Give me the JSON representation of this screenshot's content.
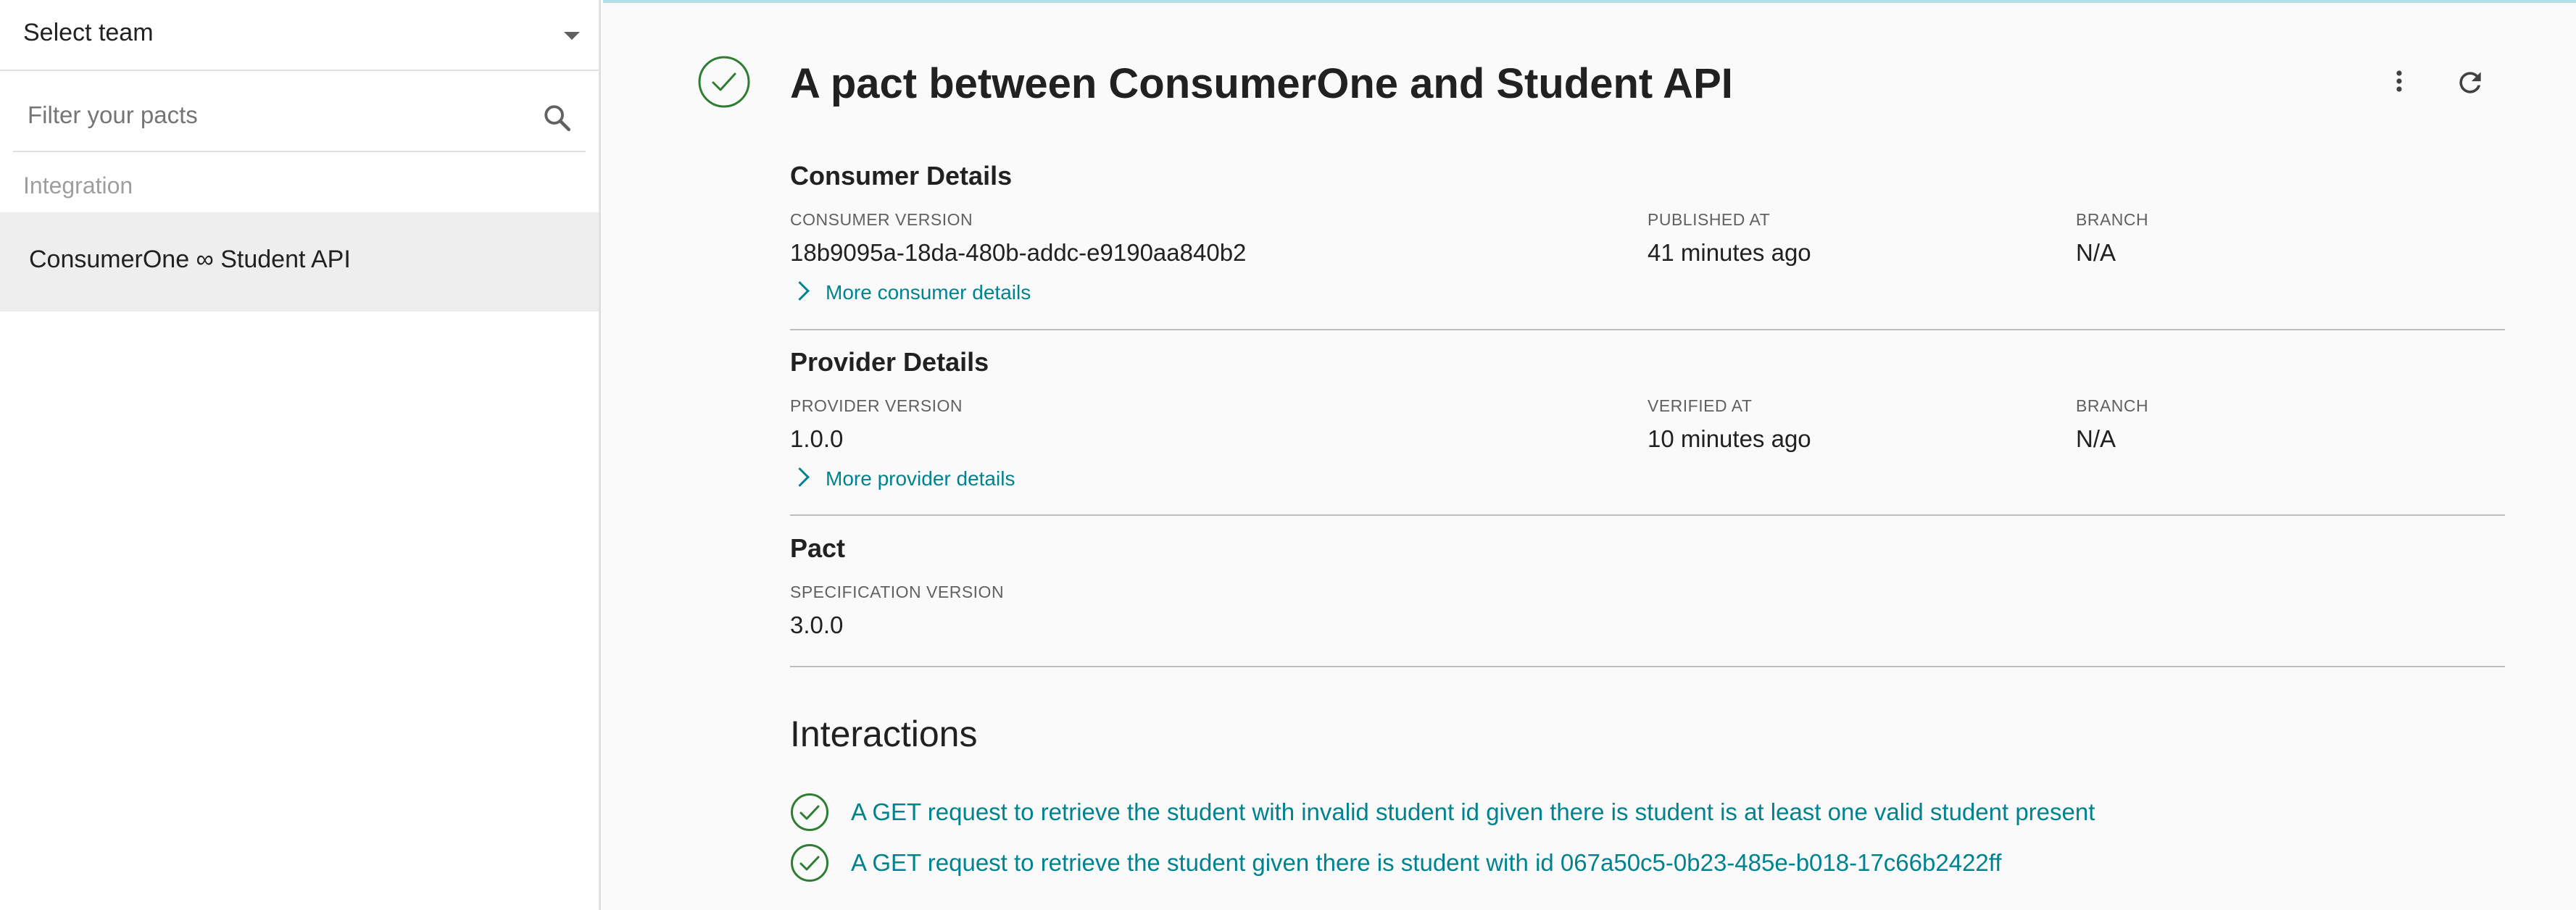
{
  "sidebar": {
    "team_select_label": "Select team",
    "filter_placeholder": "Filter your pacts",
    "group_label": "Integration",
    "items": [
      {
        "label": "ConsumerOne ∞ Student API",
        "selected": true
      }
    ]
  },
  "header": {
    "title": "A pact between ConsumerOne and Student API",
    "status": "verified"
  },
  "consumer": {
    "title": "Consumer Details",
    "version_label": "CONSUMER VERSION",
    "version": "18b9095a-18da-480b-addc-e9190aa840b2",
    "published_label": "PUBLISHED AT",
    "published": "41 minutes ago",
    "branch_label": "BRANCH",
    "branch": "N/A",
    "more_label": "More consumer details"
  },
  "provider": {
    "title": "Provider Details",
    "version_label": "PROVIDER VERSION",
    "version": "1.0.0",
    "verified_label": "VERIFIED AT",
    "verified": "10 minutes ago",
    "branch_label": "BRANCH",
    "branch": "N/A",
    "more_label": "More provider details"
  },
  "pact": {
    "title": "Pact",
    "spec_label": "SPECIFICATION VERSION",
    "spec": "3.0.0"
  },
  "interactions": {
    "title": "Interactions",
    "items": [
      {
        "label": "A GET request to retrieve the student with invalid student id given there is student is at least one valid student present",
        "status": "verified"
      },
      {
        "label": "A GET request to retrieve the student given there is student with id 067a50c5-0b23-485e-b018-17c66b2422ff",
        "status": "verified"
      }
    ]
  },
  "colors": {
    "accent": "#00838f",
    "success": "#2e7d32",
    "selected_bg": "#eeeeee"
  }
}
